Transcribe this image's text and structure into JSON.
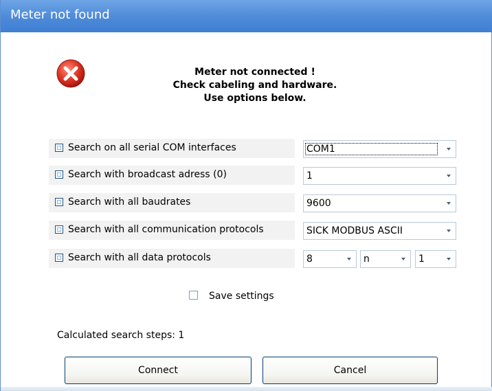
{
  "window": {
    "title": "Meter not found"
  },
  "message": {
    "line1": "Meter not connected !",
    "line2": "Check cabeling and hardware.",
    "line3": "Use options below."
  },
  "options": [
    {
      "label": "Search on all serial COM interfaces",
      "checked": false,
      "combo": "COM1"
    },
    {
      "label": "Search with broadcast adress (0)",
      "checked": false,
      "combo": "1"
    },
    {
      "label": "Search with all baudrates",
      "checked": false,
      "combo": "9600"
    },
    {
      "label": "Search with all communication protocols",
      "checked": false,
      "combo": "SICK MODBUS ASCII"
    },
    {
      "label": "Search with all data protocols",
      "checked": false,
      "data_bits": "8",
      "parity": "n",
      "stop_bits": "1"
    }
  ],
  "save_settings": {
    "label": "Save settings",
    "checked": false
  },
  "search_steps": "Calculated search steps: 1",
  "buttons": {
    "connect": "Connect",
    "cancel": "Cancel"
  },
  "icons": {
    "error": "error-x-icon",
    "dropdown": "chevron-down-icon"
  },
  "colors": {
    "titlebar": "#4e8ad8",
    "error_red": "#d62a1e",
    "row_bg": "#f2f2f2"
  }
}
